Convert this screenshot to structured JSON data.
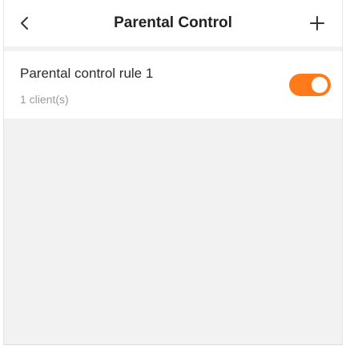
{
  "header": {
    "title": "Parental Control",
    "back_icon": "chevron-left-icon",
    "add_icon": "plus-icon"
  },
  "rules": [
    {
      "name": "Parental control rule 1",
      "clients": "1 client(s)",
      "enabled": true
    }
  ],
  "colors": {
    "accent": "#ff7a1a",
    "background": "#f2f2f2",
    "card": "#ffffff",
    "title_text": "#222222",
    "secondary_text": "#9a9a9a"
  }
}
